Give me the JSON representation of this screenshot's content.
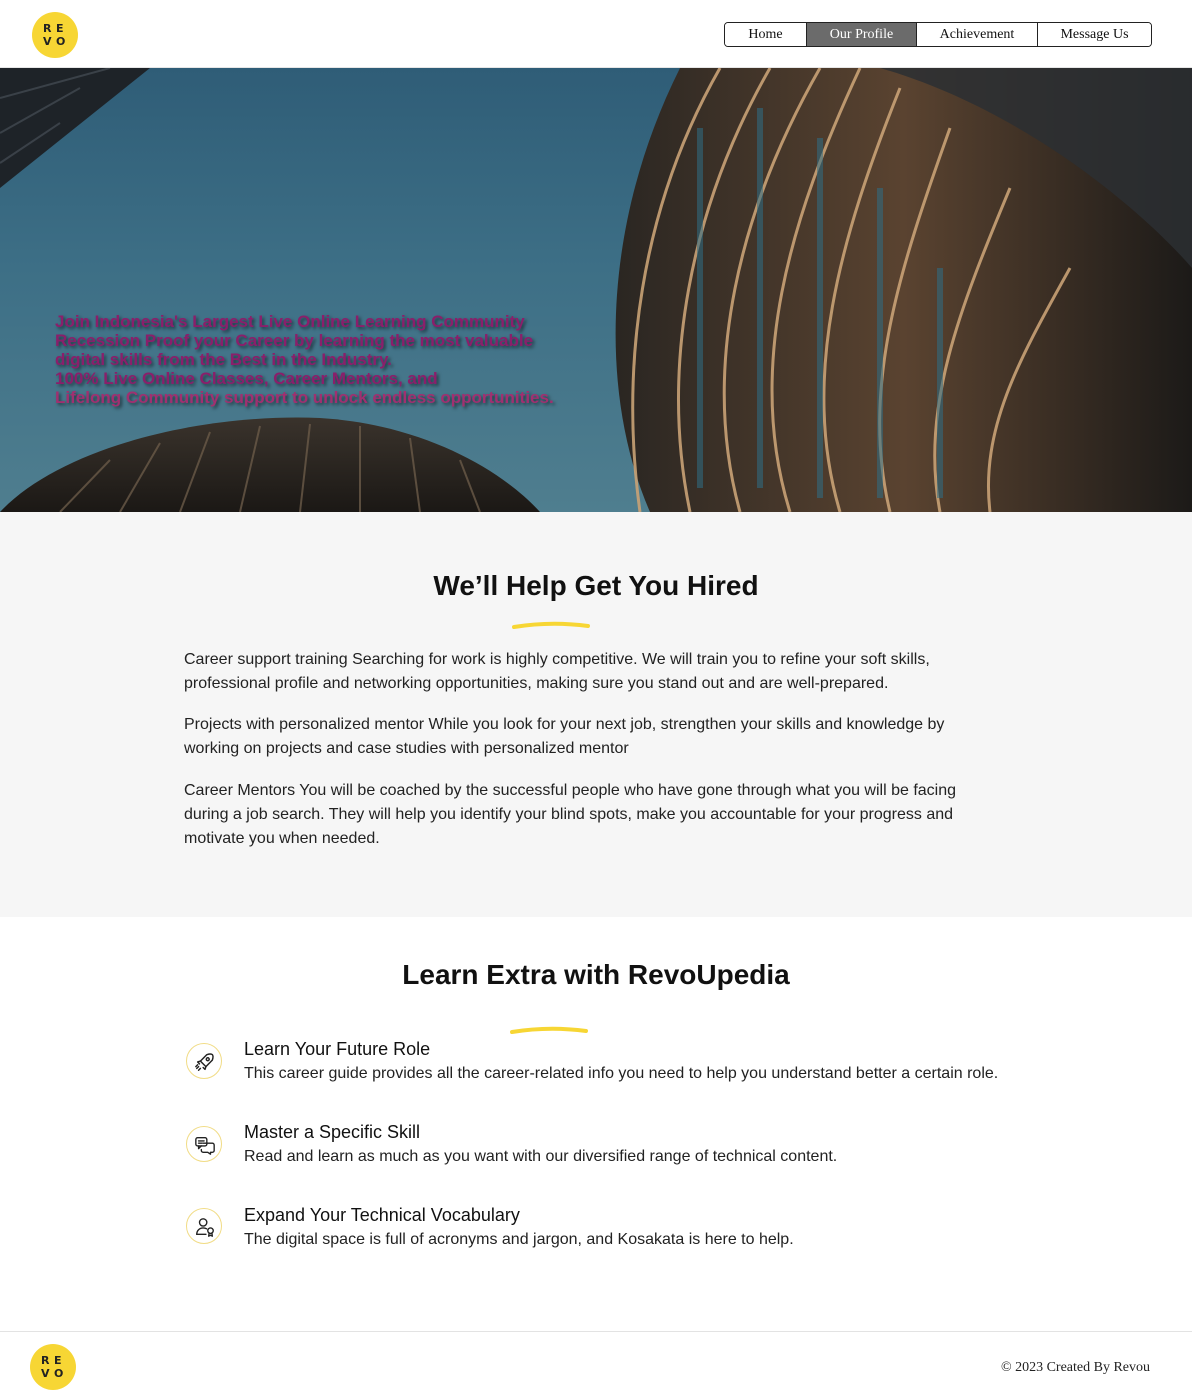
{
  "header": {
    "logo": {
      "glyphs": [
        "R",
        "E",
        "V",
        "O"
      ]
    },
    "nav": [
      {
        "label": "Home",
        "active": false
      },
      {
        "label": "Our Profile",
        "active": true
      },
      {
        "label": "Achievement",
        "active": false
      },
      {
        "label": "Message Us",
        "active": false
      }
    ]
  },
  "hero": {
    "lines": [
      "Join Indonesia's Largest Live Online Learning Community",
      "Recession Proof your Career by learning the most valuable",
      "digital skills from the Best in the Industry.",
      "100% Live Online Classes, Career Mentors, and",
      "Lifelong Community support to unlock endless opportunities."
    ]
  },
  "help": {
    "title": "We’ll Help Get You Hired",
    "paragraphs": [
      "Career support training Searching for work is highly competitive. We will train you to refine your soft skills, professional profile and networking opportunities, making sure you stand out and are well-prepared.",
      "Projects with personalized mentor While you look for your next job, strengthen your skills and knowledge by working on projects and case studies with personalized mentor",
      "Career Mentors You will be coached by the successful people who have gone through what you will be facing during a job search. They will help you identify your blind spots, make you accountable for your progress and motivate you when needed."
    ]
  },
  "learn": {
    "title": "Learn Extra with RevoUpedia",
    "features": [
      {
        "icon": "rocket-icon",
        "title": "Learn Your Future Role",
        "desc": "This career guide provides all the career-related info you need to help you understand better a certain role."
      },
      {
        "icon": "chat-bubbles-icon",
        "title": "Master a Specific Skill",
        "desc": "Read and learn as much as you want with our diversified range of technical content."
      },
      {
        "icon": "user-badge-icon",
        "title": "Expand Your Technical Vocabulary",
        "desc": "The digital space is full of acronyms and jargon, and Kosakata is here to help."
      }
    ]
  },
  "footer": {
    "copyright": "© 2023 Created By Revou"
  },
  "colors": {
    "accent": "#f7d634",
    "nav_active": "#6b6b6b",
    "section_bg": "#f6f6f6",
    "hero_text": "#8a1f6b"
  }
}
